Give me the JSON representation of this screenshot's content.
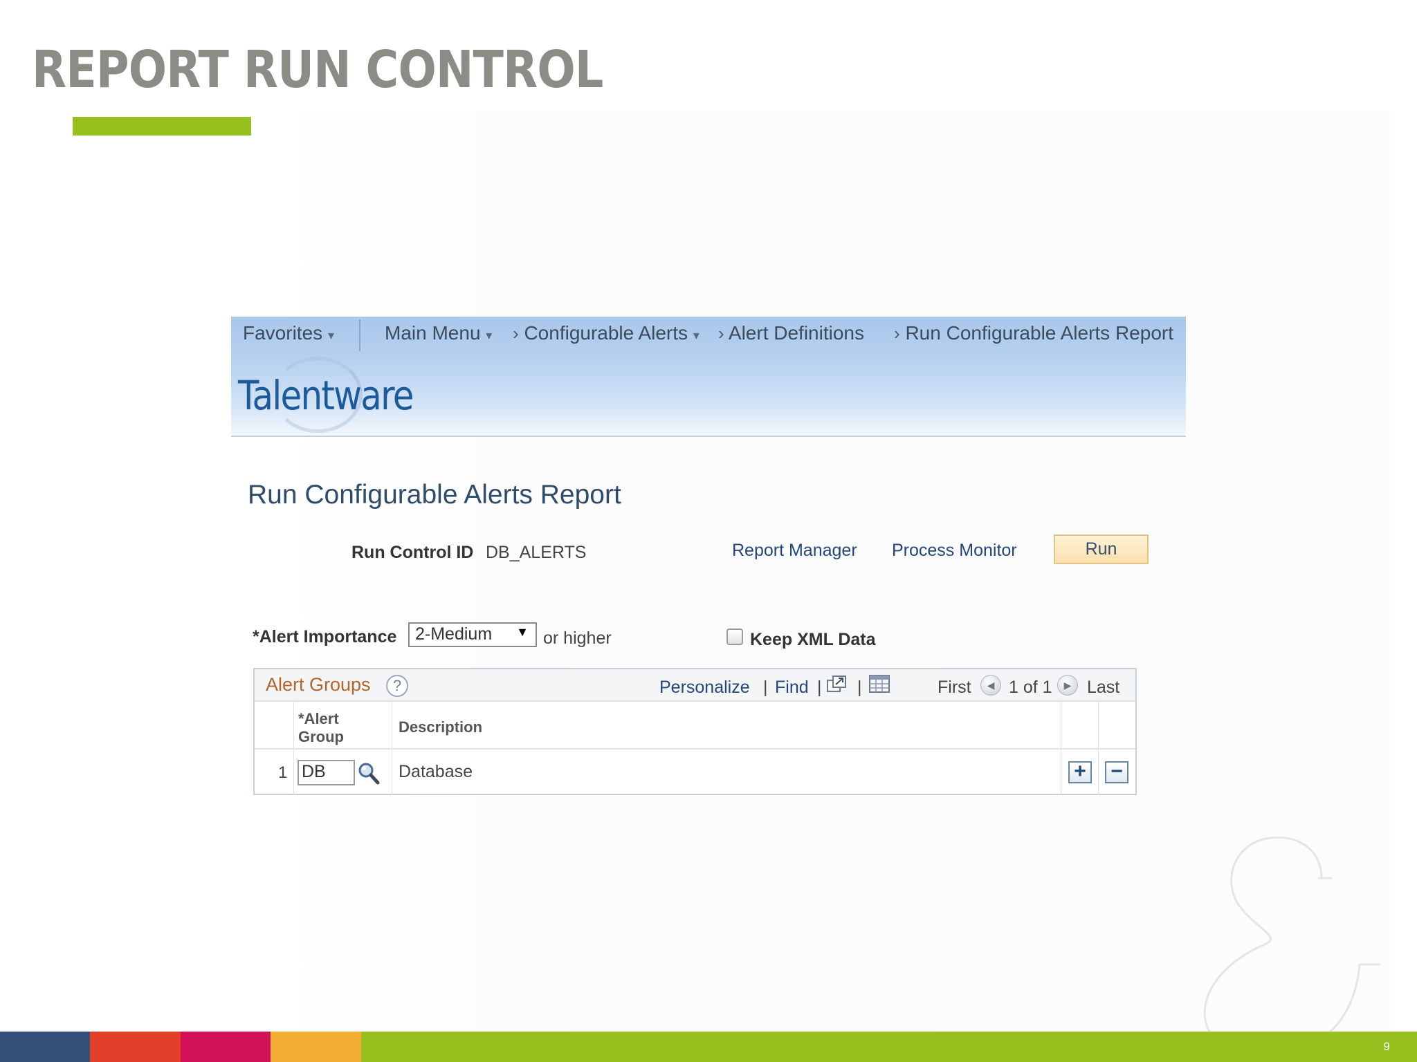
{
  "slide": {
    "title": "REPORT RUN CONTROL",
    "page_number": "9",
    "colors": {
      "title": "#8a8c86",
      "accent_green": "#95c01e",
      "bar": [
        "#34507a",
        "#e2402b",
        "#d3125a",
        "#f4ad35",
        "#95c01e"
      ]
    }
  },
  "navbar": {
    "favorites": "Favorites",
    "main_menu": "Main Menu",
    "breadcrumb_configurable_alerts": "Configurable Alerts",
    "breadcrumb_alert_definitions": "Alert Definitions",
    "breadcrumb_run_report": "Run Configurable Alerts Report"
  },
  "logo": {
    "text": "Talentware"
  },
  "page": {
    "heading": "Run Configurable Alerts Report",
    "run_control_label": "Run Control ID",
    "run_control_value": "DB_ALERTS",
    "report_manager_link": "Report Manager",
    "process_monitor_link": "Process Monitor",
    "run_button": "Run"
  },
  "form": {
    "alert_importance_label": "*Alert Importance",
    "alert_importance_value": "2-Medium",
    "or_higher": "or higher",
    "keep_xml_label": "Keep XML Data",
    "keep_xml_checked": false
  },
  "grid": {
    "title": "Alert Groups",
    "help": "?",
    "personalize": "Personalize",
    "find": "Find",
    "separator": "|",
    "first": "First",
    "range": "1 of 1",
    "last": "Last",
    "columns": {
      "alert_group_line1": "*Alert",
      "alert_group_line2": "Group",
      "description": "Description"
    },
    "rows": [
      {
        "num": "1",
        "alert_group": "DB",
        "description": "Database"
      }
    ],
    "add_button": "+",
    "remove_button": "−"
  }
}
